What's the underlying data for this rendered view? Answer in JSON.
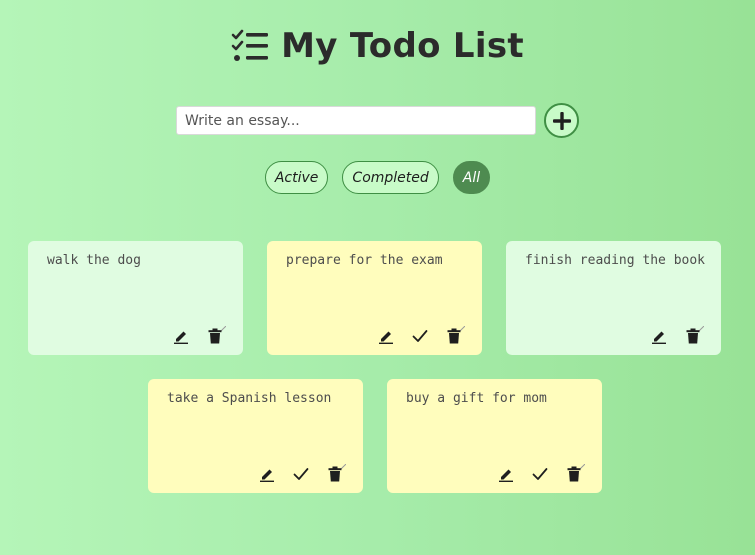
{
  "header": {
    "title": "My Todo List",
    "icon": "list-checks-icon"
  },
  "input": {
    "placeholder": "Write an essay...",
    "value": ""
  },
  "add_button": {
    "icon": "plus-circle-icon"
  },
  "filters": [
    {
      "label": "Active",
      "selected": false
    },
    {
      "label": "Completed",
      "selected": false
    },
    {
      "label": "All",
      "selected": true
    }
  ],
  "todos": [
    {
      "text": "walk the dog",
      "completed": true
    },
    {
      "text": "prepare for the exam",
      "completed": false
    },
    {
      "text": "finish reading the book",
      "completed": true
    },
    {
      "text": "take a Spanish lesson",
      "completed": false
    },
    {
      "text": "buy a gift for mom",
      "completed": false
    }
  ],
  "colors": {
    "completed_card": "#e0fce1",
    "pending_card": "#fffdbd",
    "accent": "#4e8b50"
  }
}
